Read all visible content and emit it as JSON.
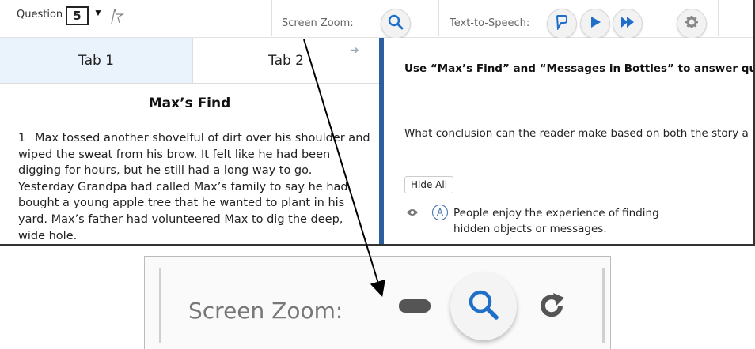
{
  "toolbar": {
    "question_label": "Question",
    "question_number": "5",
    "screen_zoom_label": "Screen Zoom:",
    "tts_label": "Text-to-Speech:"
  },
  "tabs": [
    {
      "label": "Tab 1",
      "active": true
    },
    {
      "label": "Tab 2",
      "active": false
    }
  ],
  "passage": {
    "title": "Max’s Find",
    "paragraph_number": "1",
    "text": "Max tossed another shovelful of dirt over his shoulder and wiped the sweat from his brow. It felt like he had been digging for hours, but he still had a long way to go. Yesterday Grandpa had called Max’s family to say he had bought a young apple tree that he wanted to plant in his yard. Max’s father had volunteered Max to dig the deep, wide hole."
  },
  "question_pane": {
    "instruction": "Use “Max’s Find” and “Messages in Bottles” to answer quest",
    "question": "What conclusion can the reader make based on both the story a",
    "hide_all_label": "Hide All",
    "options": [
      {
        "letter": "A",
        "text": "People enjoy the experience of finding hidden objects or messages."
      }
    ]
  },
  "zoom_callout": {
    "label": "Screen Zoom:"
  },
  "colors": {
    "divider": "#2c5f9e",
    "accent_blue": "#1f6fc9",
    "active_tab_bg": "#eaf2fb"
  },
  "icons": [
    "flag-icon",
    "caret-down-icon",
    "search-icon",
    "speech-bubble-icon",
    "play-icon",
    "fast-forward-icon",
    "gear-icon",
    "arrow-right-icon",
    "eye-icon",
    "minus-icon",
    "refresh-icon"
  ]
}
